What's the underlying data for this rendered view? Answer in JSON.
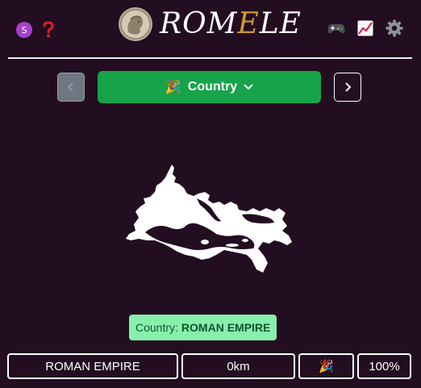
{
  "header": {
    "user_initial": "S",
    "title_pre": "ROM",
    "title_accent": "E",
    "title_post": "LE",
    "icons": [
      "avatar",
      "help-icon",
      "game-controller-icon",
      "stats-chart-icon",
      "gear-icon"
    ]
  },
  "nav": {
    "mode_emoji": "🎉",
    "mode_label": "Country"
  },
  "result": {
    "label": "Country:",
    "answer": "ROMAN EMPIRE"
  },
  "guess": {
    "name": "ROMAN EMPIRE",
    "distance": "0km",
    "direction_emoji": "🎉",
    "proximity": "100%"
  },
  "colors": {
    "background": "#220d21",
    "primary_green": "#16a34a",
    "answer_bg": "#86efac",
    "title_accent": "#d29b2a",
    "avatar": "#a541c9"
  }
}
